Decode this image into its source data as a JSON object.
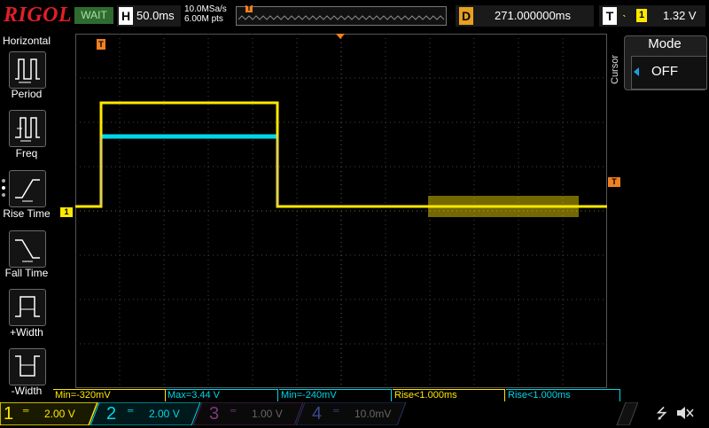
{
  "brand": "RIGOL",
  "run_status": "WAIT",
  "horizontal": {
    "key": "H",
    "timebase": "50.0ms",
    "sample_rate": "10.0MSa/s",
    "memory_depth": "6.00M pts"
  },
  "delay": {
    "key": "D",
    "value": "271.000000ms"
  },
  "trigger": {
    "key": "T",
    "edge_icon": "rising-edge-icon",
    "source": "1",
    "level": "1.32 V"
  },
  "left_panel": {
    "title": "Horizontal",
    "items": [
      {
        "label": "Period",
        "icon": "period-icon"
      },
      {
        "label": "Freq",
        "icon": "frequency-icon"
      },
      {
        "label": "Rise Time",
        "icon": "rise-time-icon"
      },
      {
        "label": "Fall Time",
        "icon": "fall-time-icon"
      },
      {
        "label": "+Width",
        "icon": "positive-width-icon"
      },
      {
        "label": "-Width",
        "icon": "negative-width-icon"
      }
    ]
  },
  "markers": {
    "trigger_pos": "T",
    "trigger_level": "T",
    "ch1_ref": "1"
  },
  "cursor_menu": {
    "side_label": "Cursor",
    "title": "Mode",
    "value": "OFF"
  },
  "measurements": [
    {
      "text": "Min=-320mV",
      "channel": 1
    },
    {
      "text": "Max=3.44 V",
      "channel": 2
    },
    {
      "text": "Min=-240mV",
      "channel": 2
    },
    {
      "text": "Rise<1.000ms",
      "channel": 1
    },
    {
      "text": "Rise<1.000ms",
      "channel": 2
    }
  ],
  "channels": [
    {
      "num": "1",
      "scale": "2.00 V",
      "color": "#ffe800",
      "active": true
    },
    {
      "num": "2",
      "scale": "2.00 V",
      "color": "#00d8e8",
      "active": true
    },
    {
      "num": "3",
      "scale": "1.00 V",
      "color": "#c040c0",
      "active": false
    },
    {
      "num": "4",
      "scale": "10.0mV",
      "color": "#3050ff",
      "active": false
    }
  ],
  "colors": {
    "ch1": "#ffe800",
    "ch2": "#00d8e8",
    "trigger": "#f08020",
    "brand": "#e21f26"
  },
  "status_icons": [
    "usb-icon",
    "speaker-muted-icon"
  ]
}
